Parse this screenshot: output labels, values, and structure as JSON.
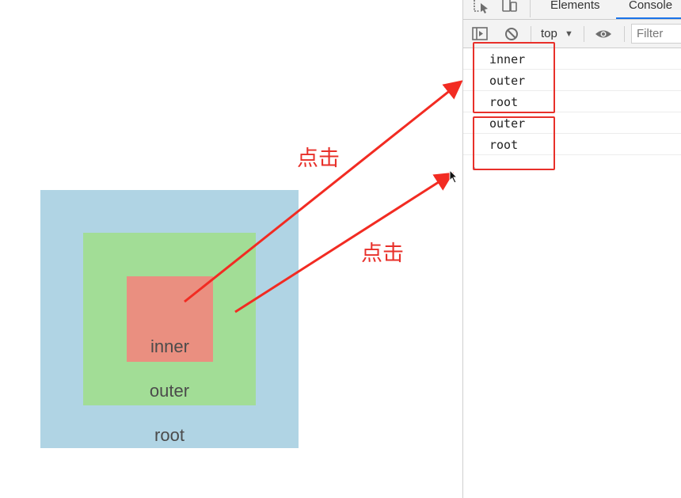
{
  "page": {
    "root_label": "root",
    "outer_label": "outer",
    "inner_label": "inner",
    "annotation_click_1": "点击",
    "annotation_click_2": "点击",
    "colors": {
      "root": "#b0d4e4",
      "outer": "#a2dd96",
      "inner": "#ea8f80",
      "annotation": "#e8302a"
    }
  },
  "devtools": {
    "tabs": [
      {
        "label": "Elements",
        "active": false
      },
      {
        "label": "Console",
        "active": true
      }
    ],
    "toolbar": {
      "context": "top",
      "filter_placeholder": "Filter",
      "icons": [
        "inspect-element-icon",
        "device-toolbar-icon",
        "sidebar-toggle-icon",
        "clear-console-icon",
        "live-expression-eye-icon"
      ]
    },
    "console_logs": [
      {
        "text": "inner"
      },
      {
        "text": "outer"
      },
      {
        "text": "root"
      },
      {
        "text": "outer"
      },
      {
        "text": "root"
      }
    ],
    "prompt_symbol": "›"
  }
}
